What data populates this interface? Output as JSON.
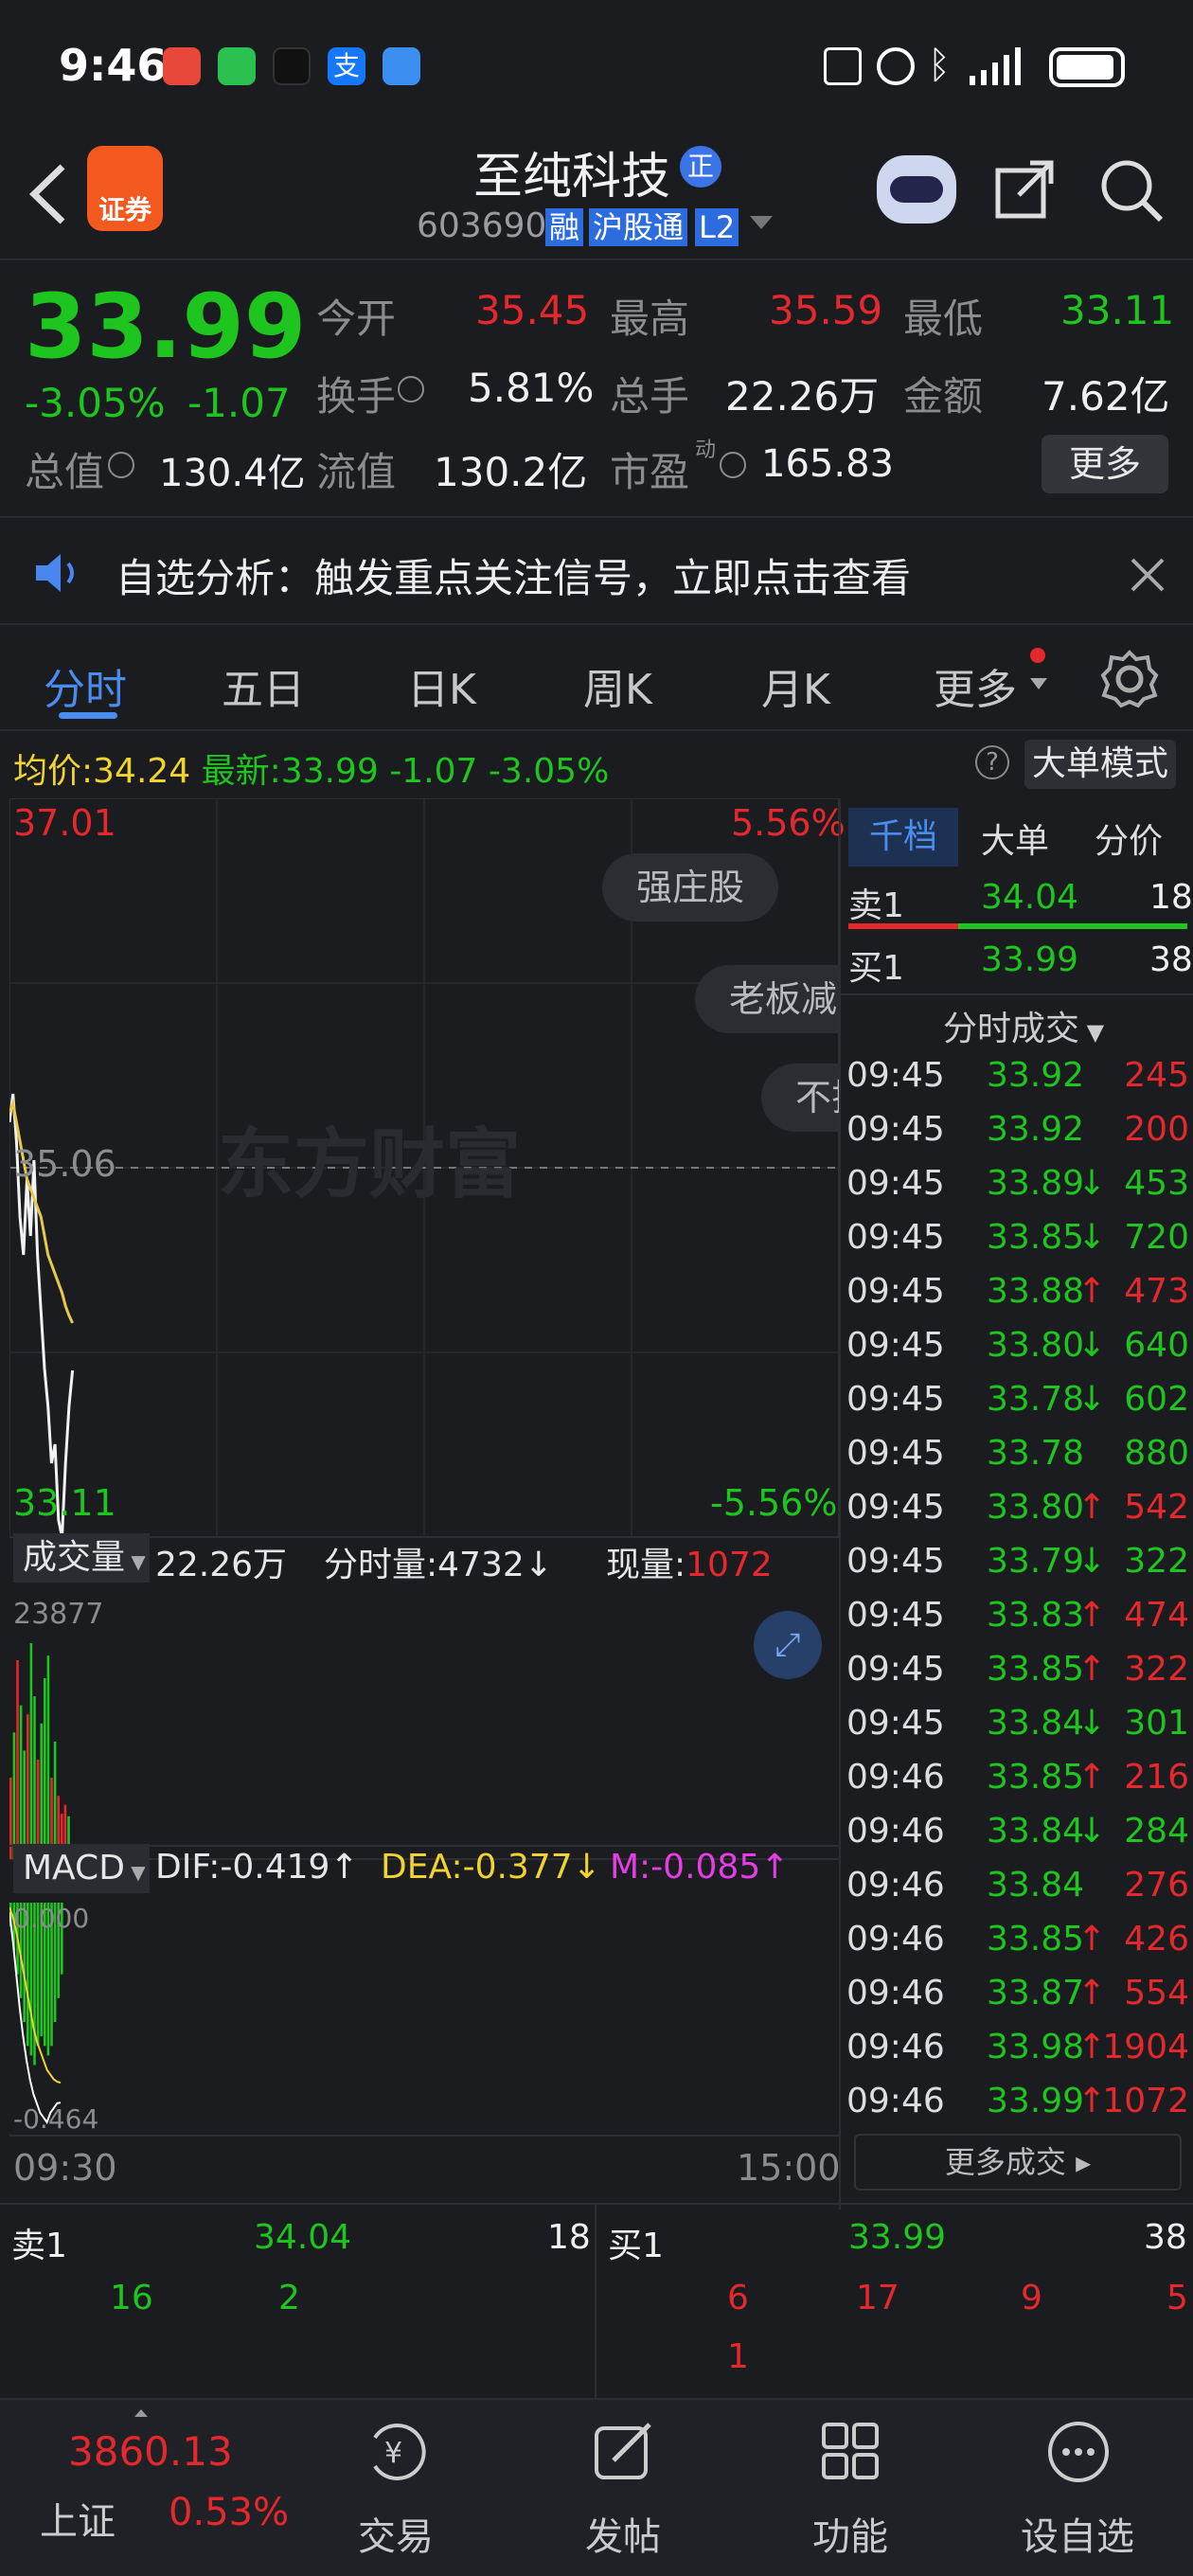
{
  "status_bar": {
    "time": "9:46"
  },
  "header": {
    "stock_name": "至纯科技",
    "badge": "正",
    "code": "603690",
    "tags": [
      "融",
      "沪股通",
      "L2"
    ],
    "app_label": "证券"
  },
  "quote": {
    "price": "33.99",
    "change_pct": "-3.05%",
    "change": "-1.07",
    "stats": [
      {
        "label": "今开",
        "value": "35.45",
        "color": "red"
      },
      {
        "label": "最高",
        "value": "35.59",
        "color": "red"
      },
      {
        "label": "最低",
        "value": "33.11",
        "color": "green"
      },
      {
        "label": "换手",
        "value": "5.81%",
        "color": "white"
      },
      {
        "label": "总手",
        "value": "22.26万",
        "color": "white"
      },
      {
        "label": "金额",
        "value": "7.62亿",
        "color": "white"
      },
      {
        "label": "总值",
        "value": "130.4亿",
        "color": "white"
      },
      {
        "label": "流值",
        "value": "130.2亿",
        "color": "white"
      },
      {
        "label": "市盈",
        "sup": "动",
        "value": "165.83",
        "color": "white"
      }
    ],
    "more_label": "更多"
  },
  "notice": {
    "text": "自选分析：触发重点关注信号，立即点击查看"
  },
  "tabs": [
    "分时",
    "五日",
    "日K",
    "周K",
    "月K",
    "更多"
  ],
  "info_line": {
    "avg_label": "均价:",
    "avg_value": "34.24",
    "latest_label": "最新:",
    "latest_value": "33.99",
    "change": "-1.07",
    "change_pct": "-3.05%",
    "mode_button": "大单模式"
  },
  "chart_data": {
    "type": "line",
    "title": "",
    "price_axis": {
      "top": "37.01",
      "middle": "35.06",
      "bottom": "33.11"
    },
    "pct_axis": {
      "top": "5.56%",
      "bottom": "-5.56%"
    },
    "time_axis": {
      "start": "09:30",
      "end": "15:00"
    },
    "series": [
      {
        "name": "price",
        "values": [
          35.3,
          35.45,
          35.2,
          34.8,
          34.6,
          35.0,
          34.7,
          35.1,
          34.6,
          34.3,
          34.0,
          33.8,
          33.5,
          33.6,
          33.2,
          33.11,
          33.5,
          33.8,
          33.99
        ]
      },
      {
        "name": "avg",
        "values": [
          35.35,
          35.4,
          35.3,
          35.2,
          35.1,
          35.0,
          34.95,
          34.9,
          34.85,
          34.8,
          34.7,
          34.6,
          34.55,
          34.5,
          34.45,
          34.4,
          34.33,
          34.28,
          34.24
        ]
      }
    ],
    "volume": {
      "max_label": "23877",
      "bars": [
        9000,
        14000,
        22000,
        17000,
        12000,
        16000,
        23877,
        18000,
        11000,
        15000,
        20000,
        22500,
        9000,
        13000,
        7000,
        5000,
        6000,
        4732
      ],
      "bar_colors": [
        "red",
        "green",
        "red",
        "green",
        "green",
        "red",
        "green",
        "green",
        "red",
        "green",
        "green",
        "green",
        "red",
        "green",
        "red",
        "red",
        "red",
        "green"
      ]
    },
    "macd": {
      "top_label": "0.000",
      "bottom_label": "-0.464",
      "hist": [
        -0.05,
        -0.1,
        -0.15,
        -0.2,
        -0.25,
        -0.3,
        -0.32,
        -0.34,
        -0.3,
        -0.28,
        -0.3,
        -0.32,
        -0.3,
        -0.25,
        -0.2,
        -0.15
      ],
      "dif": [
        -0.02,
        -0.08,
        -0.15,
        -0.22,
        -0.28,
        -0.33,
        -0.37,
        -0.4,
        -0.42,
        -0.44,
        -0.45,
        -0.46,
        -0.44,
        -0.43,
        -0.42,
        -0.419
      ],
      "dea": [
        -0.01,
        -0.03,
        -0.06,
        -0.1,
        -0.14,
        -0.18,
        -0.22,
        -0.26,
        -0.29,
        -0.31,
        -0.33,
        -0.35,
        -0.36,
        -0.37,
        -0.375,
        -0.377
      ]
    }
  },
  "overlay_pills": [
    "强庄股",
    "老板减",
    "不拉"
  ],
  "watermark": "东方财富",
  "volume_line": {
    "label": "成交量",
    "total": "22.26万",
    "tick_label": "分时量:",
    "tick_value": "4732",
    "cur_label": "现量:",
    "cur_value": "1072"
  },
  "macd_line": {
    "label": "MACD",
    "dif": "DIF:-0.419",
    "dea": "DEA:-0.377",
    "m": "M:-0.085"
  },
  "side_panel": {
    "tabs": [
      "千档",
      "大单",
      "分价"
    ],
    "sell1": {
      "label": "卖1",
      "price": "34.04",
      "vol": "18"
    },
    "buy1": {
      "label": "买1",
      "price": "33.99",
      "vol": "38"
    },
    "trades_title": "分时成交",
    "trades": [
      {
        "t": "09:45",
        "p": "33.92",
        "a": "",
        "v": "245",
        "vc": "red"
      },
      {
        "t": "09:45",
        "p": "33.92",
        "a": "",
        "v": "200",
        "vc": "red"
      },
      {
        "t": "09:45",
        "p": "33.89",
        "a": "↓",
        "v": "453",
        "vc": "green"
      },
      {
        "t": "09:45",
        "p": "33.85",
        "a": "↓",
        "v": "720",
        "vc": "green"
      },
      {
        "t": "09:45",
        "p": "33.88",
        "a": "↑",
        "v": "473",
        "vc": "red"
      },
      {
        "t": "09:45",
        "p": "33.80",
        "a": "↓",
        "v": "640",
        "vc": "green"
      },
      {
        "t": "09:45",
        "p": "33.78",
        "a": "↓",
        "v": "602",
        "vc": "green"
      },
      {
        "t": "09:45",
        "p": "33.78",
        "a": "",
        "v": "880",
        "vc": "green"
      },
      {
        "t": "09:45",
        "p": "33.80",
        "a": "↑",
        "v": "542",
        "vc": "red"
      },
      {
        "t": "09:45",
        "p": "33.79",
        "a": "↓",
        "v": "322",
        "vc": "green"
      },
      {
        "t": "09:45",
        "p": "33.83",
        "a": "↑",
        "v": "474",
        "vc": "red"
      },
      {
        "t": "09:45",
        "p": "33.85",
        "a": "↑",
        "v": "322",
        "vc": "red"
      },
      {
        "t": "09:45",
        "p": "33.84",
        "a": "↓",
        "v": "301",
        "vc": "green"
      },
      {
        "t": "09:46",
        "p": "33.85",
        "a": "↑",
        "v": "216",
        "vc": "red"
      },
      {
        "t": "09:46",
        "p": "33.84",
        "a": "↓",
        "v": "284",
        "vc": "green"
      },
      {
        "t": "09:46",
        "p": "33.84",
        "a": "",
        "v": "276",
        "vc": "red"
      },
      {
        "t": "09:46",
        "p": "33.85",
        "a": "↑",
        "v": "426",
        "vc": "red"
      },
      {
        "t": "09:46",
        "p": "33.87",
        "a": "↑",
        "v": "554",
        "vc": "red"
      },
      {
        "t": "09:46",
        "p": "33.98",
        "a": "↑",
        "v": "1904",
        "vc": "red"
      },
      {
        "t": "09:46",
        "p": "33.99",
        "a": "↑",
        "v": "1072",
        "vc": "red"
      }
    ],
    "more_trades": "更多成交"
  },
  "order_book": {
    "sell_label": "卖1",
    "sell_price": "34.04",
    "sell_vol": "18",
    "buy_label": "买1",
    "buy_price": "33.99",
    "buy_vol": "38",
    "sell_queue": [
      "16",
      "2"
    ],
    "buy_queue": [
      "6",
      "17",
      "9",
      "5",
      "1"
    ]
  },
  "bottom_nav": {
    "index_value": "3860.13",
    "index_name": "上证",
    "index_pct": "0.53%",
    "items": [
      "交易",
      "发帖",
      "功能",
      "设自选"
    ]
  }
}
